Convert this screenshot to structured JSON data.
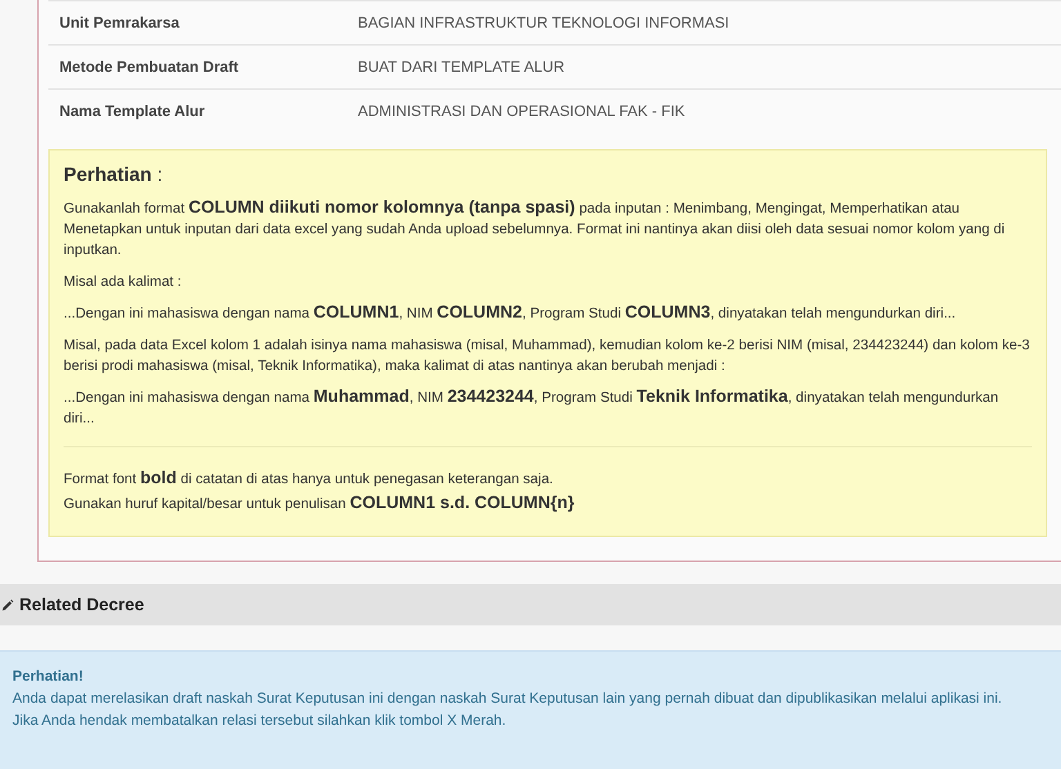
{
  "detail_rows": [
    {
      "label": "Unit Pemrakarsa",
      "value": "BAGIAN INFRASTRUKTUR TEKNOLOGI INFORMASI"
    },
    {
      "label": "Metode Pembuatan Draft",
      "value": "BUAT DARI TEMPLATE ALUR"
    },
    {
      "label": "Nama Template Alur",
      "value": "ADMINISTRASI DAN OPERASIONAL FAK - FIK"
    }
  ],
  "notice": {
    "title": "**Perhatian** :",
    "sections": [
      [
        "Gunakanlah format **COLUMN diikuti nomor kolomnya (tanpa spasi)** pada inputan : Menimbang, Mengingat, Memperhatikan atau Menetapkan untuk inputan dari data excel yang sudah Anda upload sebelumnya. Format ini nantinya akan diisi oleh data sesuai nomor kolom yang di inputkan.",
        "Misal ada kalimat :",
        "...Dengan ini mahasiswa dengan nama **COLUMN1**, NIM **COLUMN2**, Program Studi **COLUMN3**, dinyatakan telah mengundurkan diri...",
        "Misal, pada data Excel kolom 1 adalah isinya nama mahasiswa (misal, Muhammad), kemudian kolom ke-2 berisi NIM (misal, 234423244) dan kolom ke-3 berisi prodi mahasiswa (misal, Teknik Informatika), maka kalimat di atas nantinya akan berubah menjadi :",
        "...Dengan ini mahasiswa dengan nama **Muhammad**, NIM **234423244**, Program Studi **Teknik Informatika**, dinyatakan telah mengundurkan diri..."
      ],
      [
        "Format font **bold** di catatan di atas hanya untuk penegasan keterangan saja.",
        "Gunakan huruf kapital/besar untuk penulisan **COLUMN1 s.d. COLUMN{n}**"
      ]
    ]
  },
  "related": {
    "title": "Related Decree"
  },
  "info": {
    "title": "Perhatian!",
    "lines": [
      "Anda dapat merelasikan draft naskah Surat Keputusan ini dengan naskah Surat Keputusan lain yang pernah dibuat dan dipublikasikan melalui aplikasi ini.",
      "Jika Anda hendak membatalkan relasi tersebut silahkan klik tombol X Merah."
    ]
  }
}
